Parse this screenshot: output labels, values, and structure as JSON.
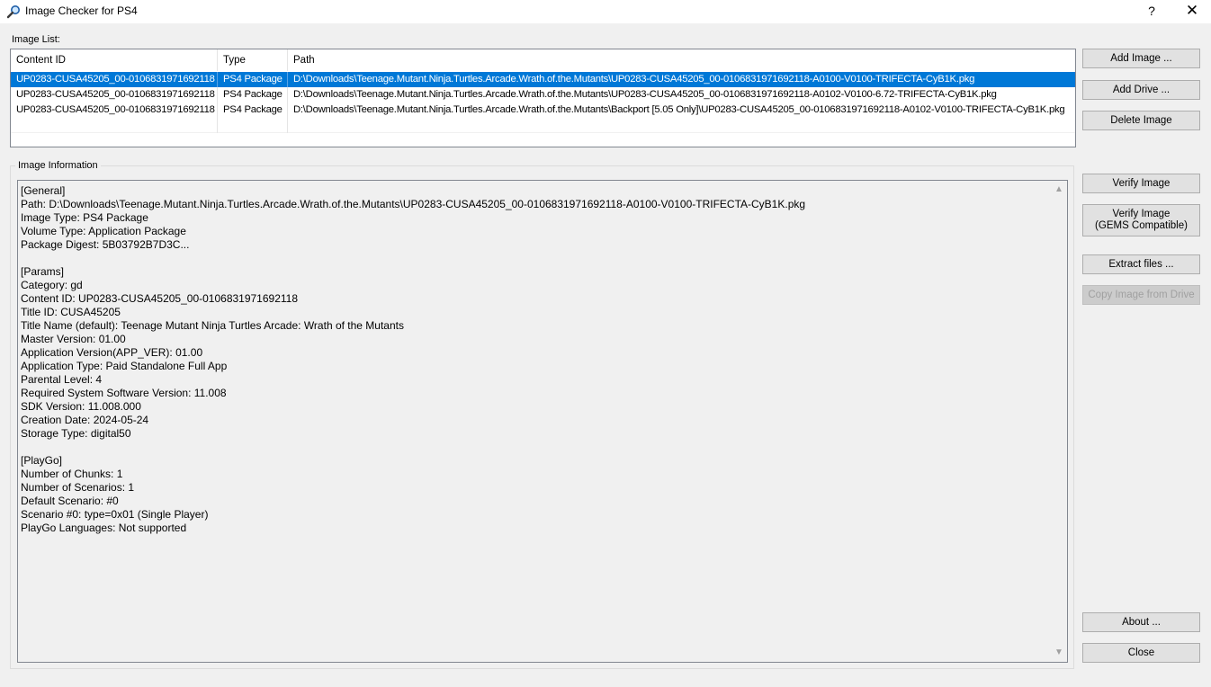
{
  "window": {
    "title": "Image Checker for PS4",
    "help_label": "?",
    "close_label": "✕"
  },
  "image_list": {
    "label": "Image List:",
    "columns": [
      "Content ID",
      "Type",
      "Path"
    ],
    "rows": [
      {
        "content_id": "UP0283-CUSA45205_00-0106831971692118",
        "type": "PS4 Package",
        "path": "D:\\Downloads\\Teenage.Mutant.Ninja.Turtles.Arcade.Wrath.of.the.Mutants\\UP0283-CUSA45205_00-0106831971692118-A0100-V0100-TRIFECTA-CyB1K.pkg",
        "selected": true
      },
      {
        "content_id": "UP0283-CUSA45205_00-0106831971692118",
        "type": "PS4 Package",
        "path": "D:\\Downloads\\Teenage.Mutant.Ninja.Turtles.Arcade.Wrath.of.the.Mutants\\UP0283-CUSA45205_00-0106831971692118-A0102-V0100-6.72-TRIFECTA-CyB1K.pkg",
        "selected": false
      },
      {
        "content_id": "UP0283-CUSA45205_00-0106831971692118",
        "type": "PS4 Package",
        "path": "D:\\Downloads\\Teenage.Mutant.Ninja.Turtles.Arcade.Wrath.of.the.Mutants\\Backport [5.05 Only]\\UP0283-CUSA45205_00-0106831971692118-A0102-V0100-TRIFECTA-CyB1K.pkg",
        "selected": false
      }
    ]
  },
  "image_information": {
    "label": "Image Information",
    "lines": [
      "[General]",
      "Path: D:\\Downloads\\Teenage.Mutant.Ninja.Turtles.Arcade.Wrath.of.the.Mutants\\UP0283-CUSA45205_00-0106831971692118-A0100-V0100-TRIFECTA-CyB1K.pkg",
      "Image Type: PS4 Package",
      "Volume Type: Application Package",
      "Package Digest: 5B03792B7D3C...",
      "",
      "[Params]",
      "Category: gd",
      "Content ID: UP0283-CUSA45205_00-0106831971692118",
      "Title ID: CUSA45205",
      "Title Name (default): Teenage Mutant Ninja Turtles Arcade: Wrath of the Mutants",
      "Master Version: 01.00",
      "Application Version(APP_VER): 01.00",
      "Application Type: Paid Standalone Full App",
      "Parental Level: 4",
      "Required System Software Version: 11.008",
      "SDK Version: 11.008.000",
      "Creation Date: 2024-05-24",
      "Storage Type: digital50",
      "",
      "[PlayGo]",
      "Number of Chunks: 1",
      "Number of Scenarios: 1",
      "Default Scenario: #0",
      "Scenario #0: type=0x01 (Single Player)",
      "PlayGo Languages: Not supported"
    ]
  },
  "buttons": {
    "add_image": "Add Image ...",
    "add_drive": "Add Drive ...",
    "delete_image": "Delete Image",
    "verify_image": "Verify Image",
    "verify_gems_line1": "Verify Image",
    "verify_gems_line2": "(GEMS Compatible)",
    "extract_files": "Extract files ...",
    "copy_image_from_drive": "Copy Image from Drive",
    "about": "About ...",
    "close": "Close"
  },
  "icons": {
    "app": "magnifier-icon",
    "scroll_up": "chevron-up-icon",
    "scroll_down": "chevron-down-icon"
  },
  "colors": {
    "selection": "#0078d7",
    "window_bg": "#f0f0f0"
  }
}
